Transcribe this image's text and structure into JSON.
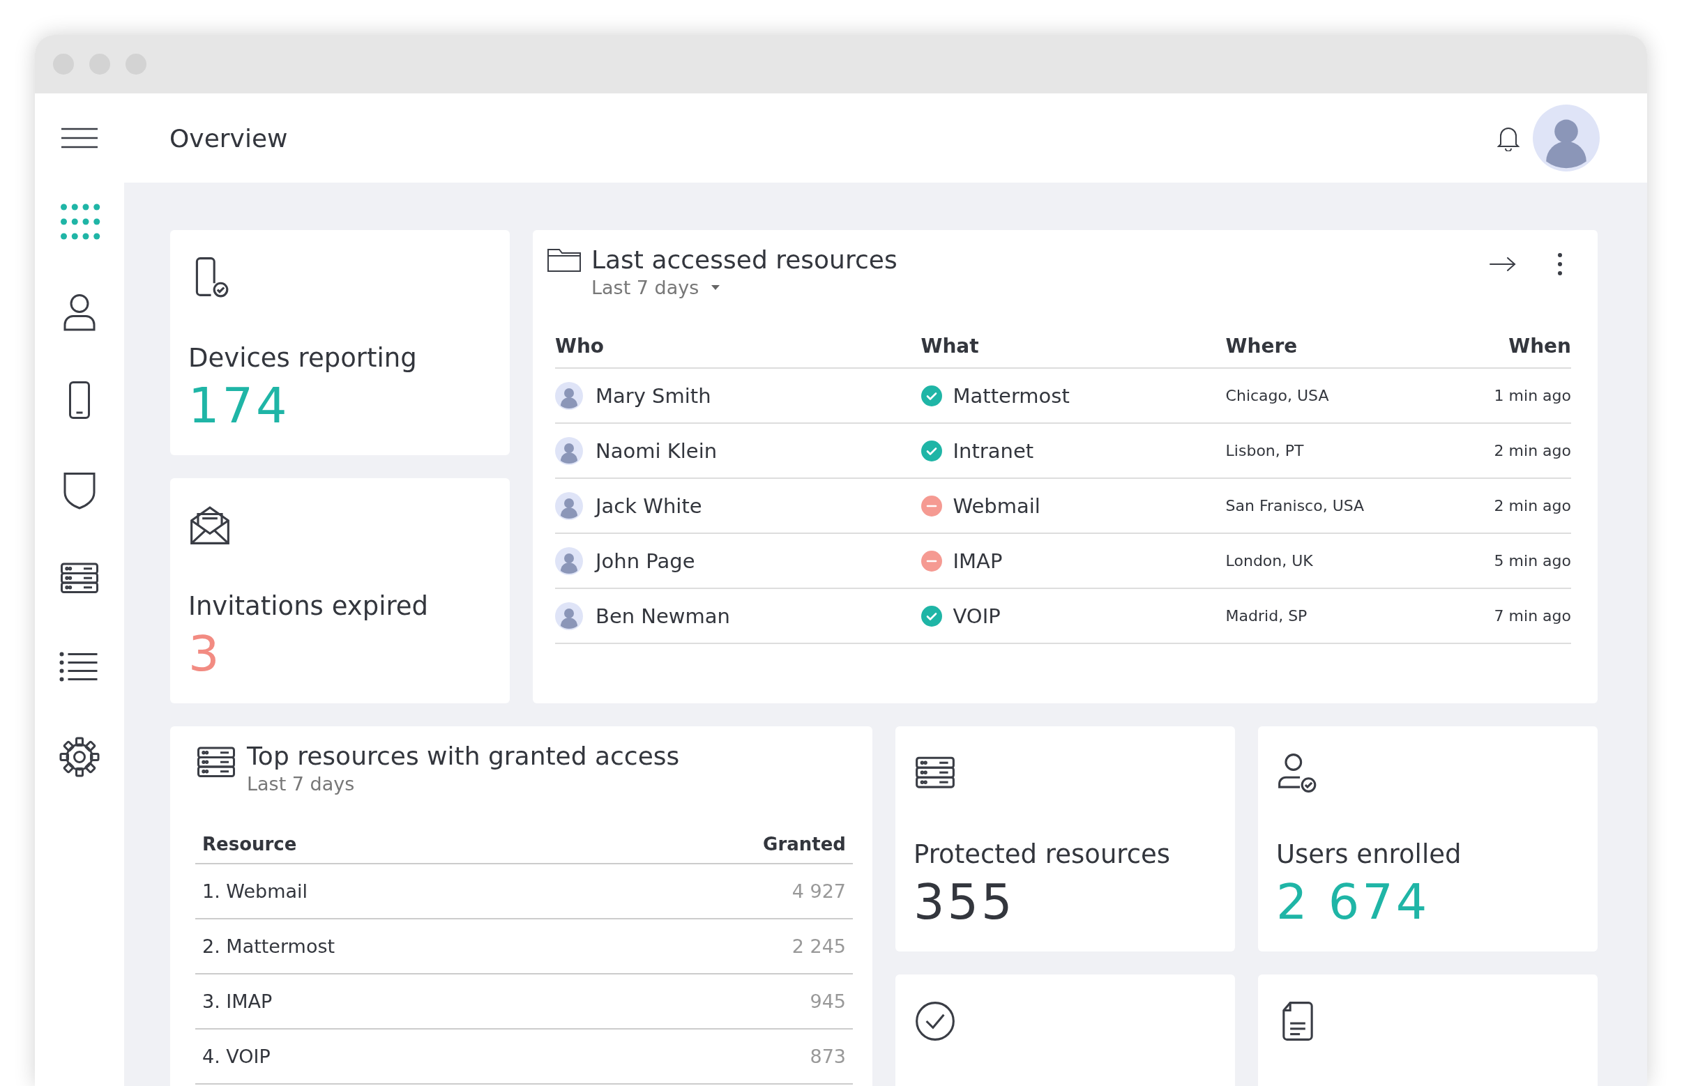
{
  "window": {
    "title": "Overview"
  },
  "sidebar": {
    "items": [
      {
        "kind": "apps",
        "selected": true
      },
      {
        "kind": "user",
        "selected": false
      },
      {
        "kind": "phone",
        "selected": false
      },
      {
        "kind": "shield",
        "selected": false
      },
      {
        "kind": "server",
        "selected": false
      },
      {
        "kind": "list",
        "selected": false
      },
      {
        "kind": "gear",
        "selected": false
      }
    ]
  },
  "stat_cards": [
    {
      "kind": "phone-check",
      "label": "Devices reporting",
      "value": "174",
      "color": "#1fb5a6"
    },
    {
      "kind": "envelope",
      "label": "Invitations expired",
      "value": "3",
      "color": "#f28b82"
    }
  ],
  "last_accessed": {
    "title": "Last accessed resources",
    "period": "Last 7 days",
    "columns": [
      "Who",
      "What",
      "Where",
      "When"
    ],
    "rows": [
      {
        "who": "Mary Smith",
        "allowed": true,
        "what": "Mattermost",
        "where": "Chicago, USA",
        "when": "1 min ago"
      },
      {
        "who": "Naomi Klein",
        "allowed": true,
        "what": "Intranet",
        "where": "Lisbon, PT",
        "when": "2 min ago"
      },
      {
        "who": "Jack White",
        "allowed": false,
        "what": "Webmail",
        "where": "San Franisco, USA",
        "when": "2 min ago"
      },
      {
        "who": "John Page",
        "allowed": false,
        "what": "IMAP",
        "where": "London, UK",
        "when": "5 min ago"
      },
      {
        "who": "Ben Newman",
        "allowed": true,
        "what": "VOIP",
        "where": "Madrid, SP",
        "when": "7 min ago"
      }
    ]
  },
  "top_resources": {
    "title": "Top resources with granted access",
    "period": "Last 7 days",
    "columns": [
      "Resource",
      "Granted"
    ],
    "rows": [
      {
        "resource": "1. Webmail",
        "granted": "4 927"
      },
      {
        "resource": "2. Mattermost",
        "granted": "2 245"
      },
      {
        "resource": "3. IMAP",
        "granted": "945"
      },
      {
        "resource": "4. VOIP",
        "granted": "873"
      }
    ]
  },
  "lower_cards": [
    {
      "kind": "server",
      "label": "Protected resources",
      "value": "355",
      "color": "#33363d"
    },
    {
      "kind": "user-check",
      "label": "Users enrolled",
      "value": "2 674",
      "color": "#1fb5a6"
    },
    {
      "kind": "check-circle"
    },
    {
      "kind": "document"
    }
  ]
}
